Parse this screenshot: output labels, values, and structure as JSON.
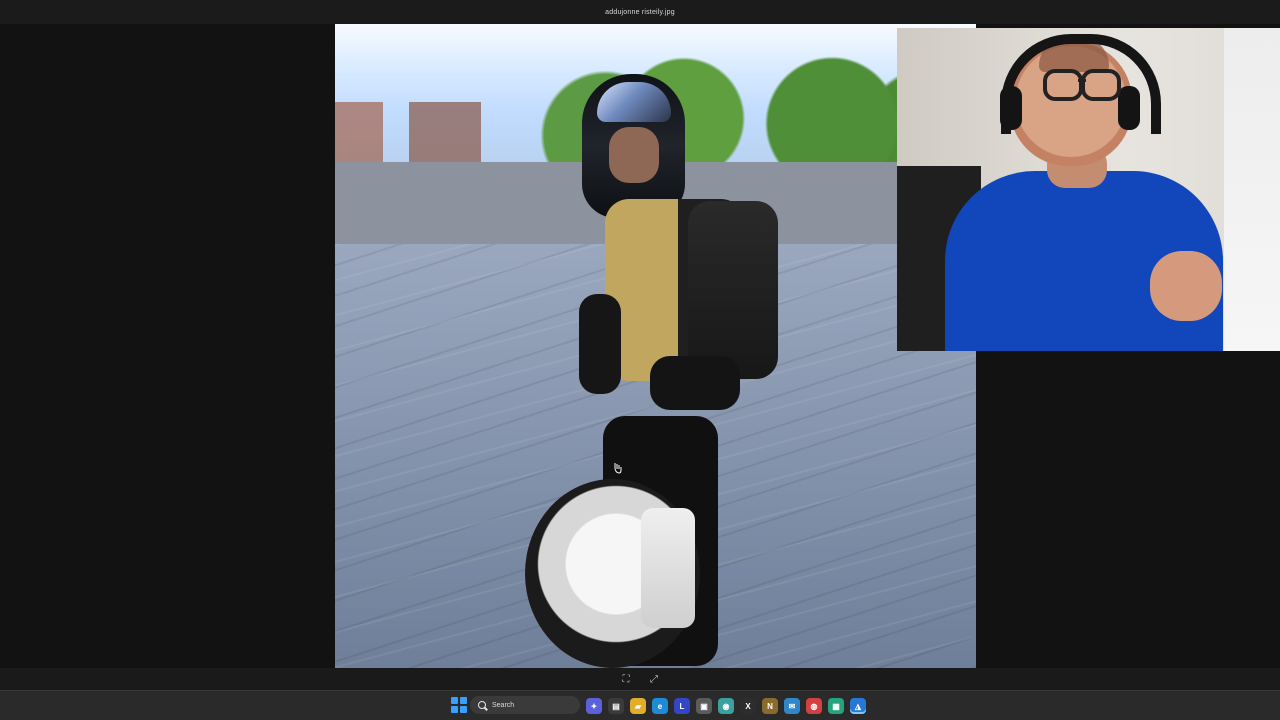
{
  "window": {
    "title": "addujonne risteily.jpg"
  },
  "viewer": {
    "image_name": "addujonne risteily.jpg"
  },
  "controls": {
    "fit_label": "⛶",
    "fullscreen_label": "⤢"
  },
  "taskbar": {
    "search_label": "Search",
    "apps": [
      {
        "name": "widgets-icon",
        "glyph": "✦"
      },
      {
        "name": "calendar-icon",
        "glyph": "▤"
      },
      {
        "name": "folder-icon",
        "glyph": "▰"
      },
      {
        "name": "edge-icon",
        "glyph": "e"
      },
      {
        "name": "l-app-icon",
        "glyph": "L"
      },
      {
        "name": "notes-icon",
        "glyph": "▣"
      },
      {
        "name": "globe-icon",
        "glyph": "◉"
      },
      {
        "name": "x-app-icon",
        "glyph": "X"
      },
      {
        "name": "n-app-icon",
        "glyph": "N"
      },
      {
        "name": "mail-icon",
        "glyph": "✉"
      },
      {
        "name": "chrome-icon",
        "glyph": "◍"
      },
      {
        "name": "sheet-icon",
        "glyph": "▦"
      },
      {
        "name": "photos-icon",
        "glyph": "◮"
      }
    ]
  },
  "colors": {
    "taskbar": "#2a2a2a",
    "accent": "#3aa0ff",
    "webcam_shirt": "#1147bb"
  }
}
